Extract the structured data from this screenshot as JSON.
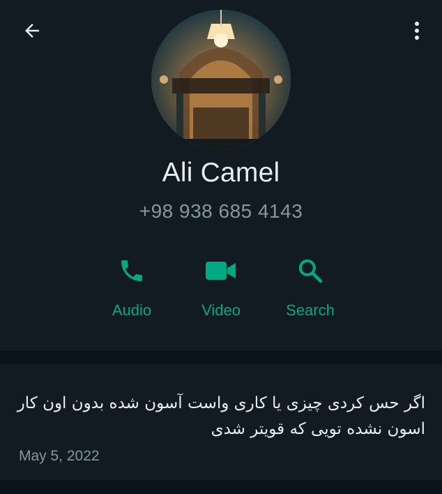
{
  "contact": {
    "name": "Ali Camel",
    "phone": "+98 938 685 4143"
  },
  "actions": {
    "audio_label": "Audio",
    "video_label": "Video",
    "search_label": "Search"
  },
  "about": {
    "text": "اگر حس کردی چیزی یا کاری واست آسون شده بدون اون کار اسون نشده تویی که قویتر شدی",
    "date": "May 5, 2022"
  },
  "icons": {
    "back": "arrow-left-icon",
    "menu": "more-vertical-icon",
    "audio": "phone-icon",
    "video": "video-camera-icon",
    "search": "search-icon"
  },
  "colors": {
    "background": "#0b141a",
    "panel": "#111b21",
    "accent": "#00a884",
    "primary_text": "#e9edef",
    "secondary_text": "#8696a0"
  }
}
